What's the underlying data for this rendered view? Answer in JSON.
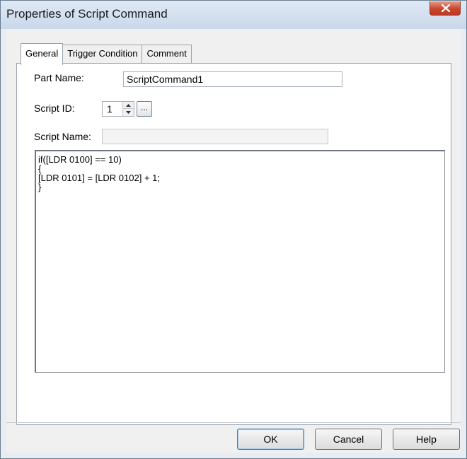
{
  "window": {
    "title": "Properties of Script Command",
    "close_icon": "close-icon"
  },
  "tabs": [
    {
      "label": "General",
      "active": true
    },
    {
      "label": "Trigger Condition",
      "active": false
    },
    {
      "label": "Comment",
      "active": false
    }
  ],
  "general": {
    "part_name_label": "Part Name:",
    "part_name_value": "ScriptCommand1",
    "script_id_label": "Script ID:",
    "script_id_value": "1",
    "browse_label": "...",
    "script_name_label": "Script Name:",
    "script_name_value": "",
    "script_lines": [
      "if([LDR 0100] == 10)",
      "{",
      "[LDR 0101] = [LDR 0102] + 1;",
      "}"
    ]
  },
  "buttons": {
    "ok": "OK",
    "cancel": "Cancel",
    "help": "Help"
  },
  "colors": {
    "close_button": "#c8452d",
    "default_button_border": "#3c7fb1"
  }
}
